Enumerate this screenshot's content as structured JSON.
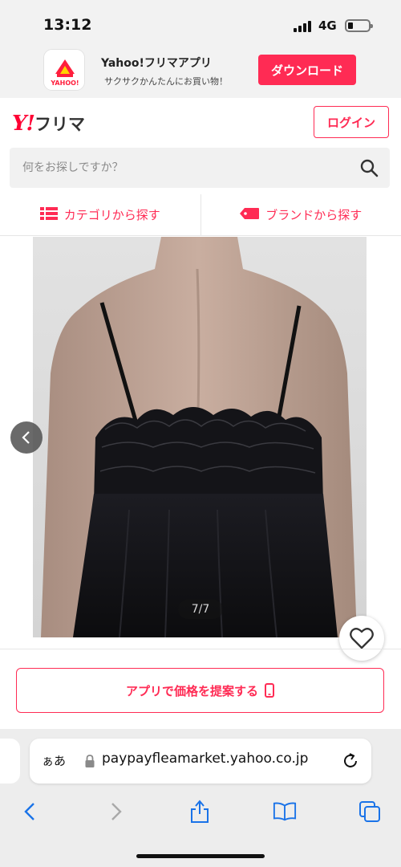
{
  "status": {
    "time": "13:12",
    "network": "4G"
  },
  "banner": {
    "app_name": "Yahoo!フリマアプリ",
    "app_subtitle": "サクサクかんたんにお買い物！",
    "download_label": "ダウンロード"
  },
  "header": {
    "logo_mark": "Y!",
    "logo_text": "フリマ",
    "login_label": "ログイン"
  },
  "search": {
    "placeholder": "何をお探しですか？"
  },
  "tabs": [
    {
      "label": "カテゴリから探す",
      "icon": "list-icon"
    },
    {
      "label": "ブランドから探す",
      "icon": "tag-icon"
    }
  ],
  "gallery": {
    "counter": "7/7"
  },
  "propose": {
    "label": "アプリで価格を提案する",
    "icon": "smartphone-icon"
  },
  "browser": {
    "text_size_label": "ぁあ",
    "url": "paypayfleamarket.yahoo.co.jp"
  },
  "colors": {
    "accent": "#ff2b54",
    "logo_red": "#ff0033"
  }
}
